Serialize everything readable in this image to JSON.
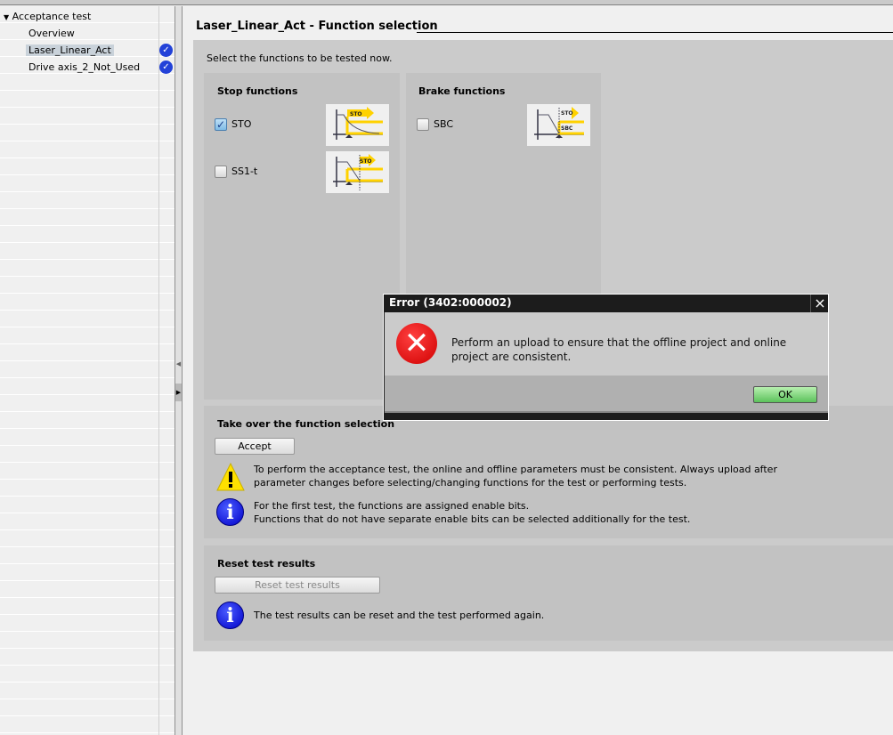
{
  "tree": {
    "root": "Acceptance test",
    "items": [
      {
        "label": "Overview",
        "checked": false
      },
      {
        "label": "Laser_Linear_Act",
        "checked": true,
        "selected": true
      },
      {
        "label": "Drive axis_2_Not_Used",
        "checked": true
      }
    ]
  },
  "main": {
    "title": "Laser_Linear_Act - Function selection",
    "instruction": "Select the functions to be tested now.",
    "stop": {
      "heading": "Stop functions",
      "items": [
        {
          "label": "STO",
          "checked": true,
          "diagram": "STO"
        },
        {
          "label": "SS1-t",
          "checked": false,
          "diagram": "STO"
        }
      ]
    },
    "brake": {
      "heading": "Brake functions",
      "items": [
        {
          "label": "SBC",
          "checked": false,
          "diagram_top": "STO",
          "diagram_bottom": "SBC"
        }
      ]
    },
    "takeover": {
      "heading": "Take over the function selection",
      "accept_label": "Accept",
      "warning": [
        "To perform the acceptance test, the online and offline parameters must be consistent. Always upload after",
        "parameter changes before selecting/changing functions for the test or performing tests."
      ],
      "info": [
        "For the first test, the functions are assigned enable bits.",
        "Functions that do not have separate enable bits can be selected additionally for the test."
      ]
    },
    "reset": {
      "heading": "Reset test results",
      "button_label": "Reset test results",
      "info": "The test results can be reset and the test performed again."
    }
  },
  "dialog": {
    "title": "Error (3402:000002)",
    "message": "Perform an upload to ensure that the offline project and online project are consistent.",
    "ok_label": "OK",
    "close": "×"
  },
  "colors": {
    "accent": "#2342d8",
    "ok": "#5cc25c",
    "error": "#d00000",
    "warning": "#ffe000"
  }
}
